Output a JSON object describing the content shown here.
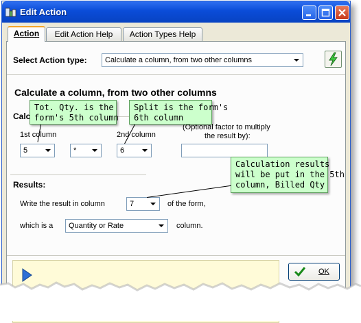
{
  "window": {
    "title": "Edit Action"
  },
  "tabs": [
    {
      "label": "Action"
    },
    {
      "label": "Edit Action Help"
    },
    {
      "label": "Action Types Help"
    }
  ],
  "action_type": {
    "label": "Select Action type:",
    "value": "Calculate a column, from two other columns"
  },
  "section_title": "Calculate a column, from two other columns",
  "calc": {
    "group_label": "Calc",
    "col1_label": "1st column",
    "col1_value": "5",
    "operator_value": "*",
    "col2_label": "2nd column",
    "col2_value": "6",
    "factor_label_line1": "(Optional factor to multiply",
    "factor_label_line2": "the result by):",
    "factor_value": ""
  },
  "results": {
    "label": "Results:",
    "write_prefix": "Write the result in column",
    "write_value": "7",
    "write_suffix": "of the form,",
    "which_prefix": "which is a",
    "which_value": "Quantity or Rate",
    "which_suffix": "column."
  },
  "callouts": {
    "c1_line1": "Tot. Qty. is the",
    "c1_line2": "form's 5th column",
    "c2_line1": "Split is the form's",
    "c2_line2": "6th column",
    "c3_line1": "Calculation results",
    "c3_line2": "will be put in the 5th",
    "c3_line3": "column, Billed Qty"
  },
  "buttons": {
    "ok": "OK"
  },
  "colors": {
    "titlebar": "#0a4cd8",
    "callout_bg": "#ccffcc",
    "footer_bg": "#fffbd8",
    "tab_accent": "#f4a428"
  },
  "icons": [
    "app-icon",
    "minimize-icon",
    "maximize-icon",
    "close-icon",
    "lightning-icon",
    "play-arrow-icon",
    "checkmark-icon"
  ]
}
